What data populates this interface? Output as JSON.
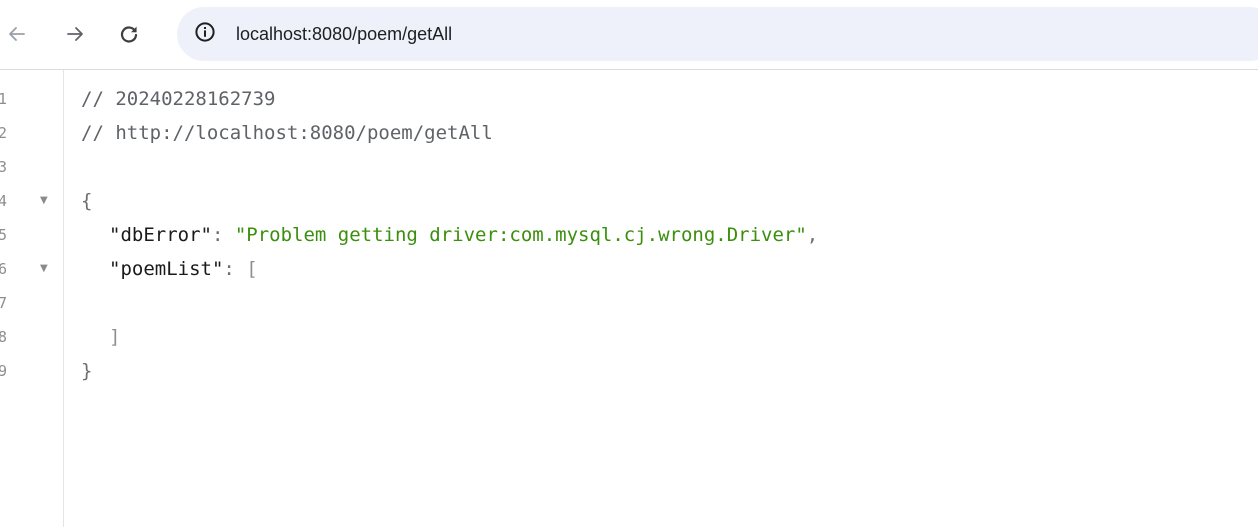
{
  "browser": {
    "url": "localhost:8080/poem/getAll",
    "icons": {
      "back": "arrow-left-icon",
      "forward": "arrow-right-icon",
      "reload": "reload-icon",
      "site_info": "info-circle-icon"
    }
  },
  "viewer": {
    "lines": [
      {
        "num": "1",
        "comment": "// 20240228162739"
      },
      {
        "num": "2",
        "comment": "// http://localhost:8080/poem/getAll"
      },
      {
        "num": "3"
      },
      {
        "num": "4",
        "open_brace": "{"
      },
      {
        "num": "5",
        "key": "\"dbError\"",
        "colon": ": ",
        "value": "\"Problem getting driver:com.mysql.cj.wrong.Driver\"",
        "comma": ","
      },
      {
        "num": "6",
        "key": "\"poemList\"",
        "colon": ": ",
        "open_bracket": "["
      },
      {
        "num": "7"
      },
      {
        "num": "8",
        "close_bracket": "]"
      },
      {
        "num": "9",
        "close_brace": "}"
      }
    ],
    "fold_marker": "▼"
  },
  "colors": {
    "string": "#3a8f0c",
    "comment": "#5f6368",
    "omnibox_bg": "#eef1f9"
  }
}
